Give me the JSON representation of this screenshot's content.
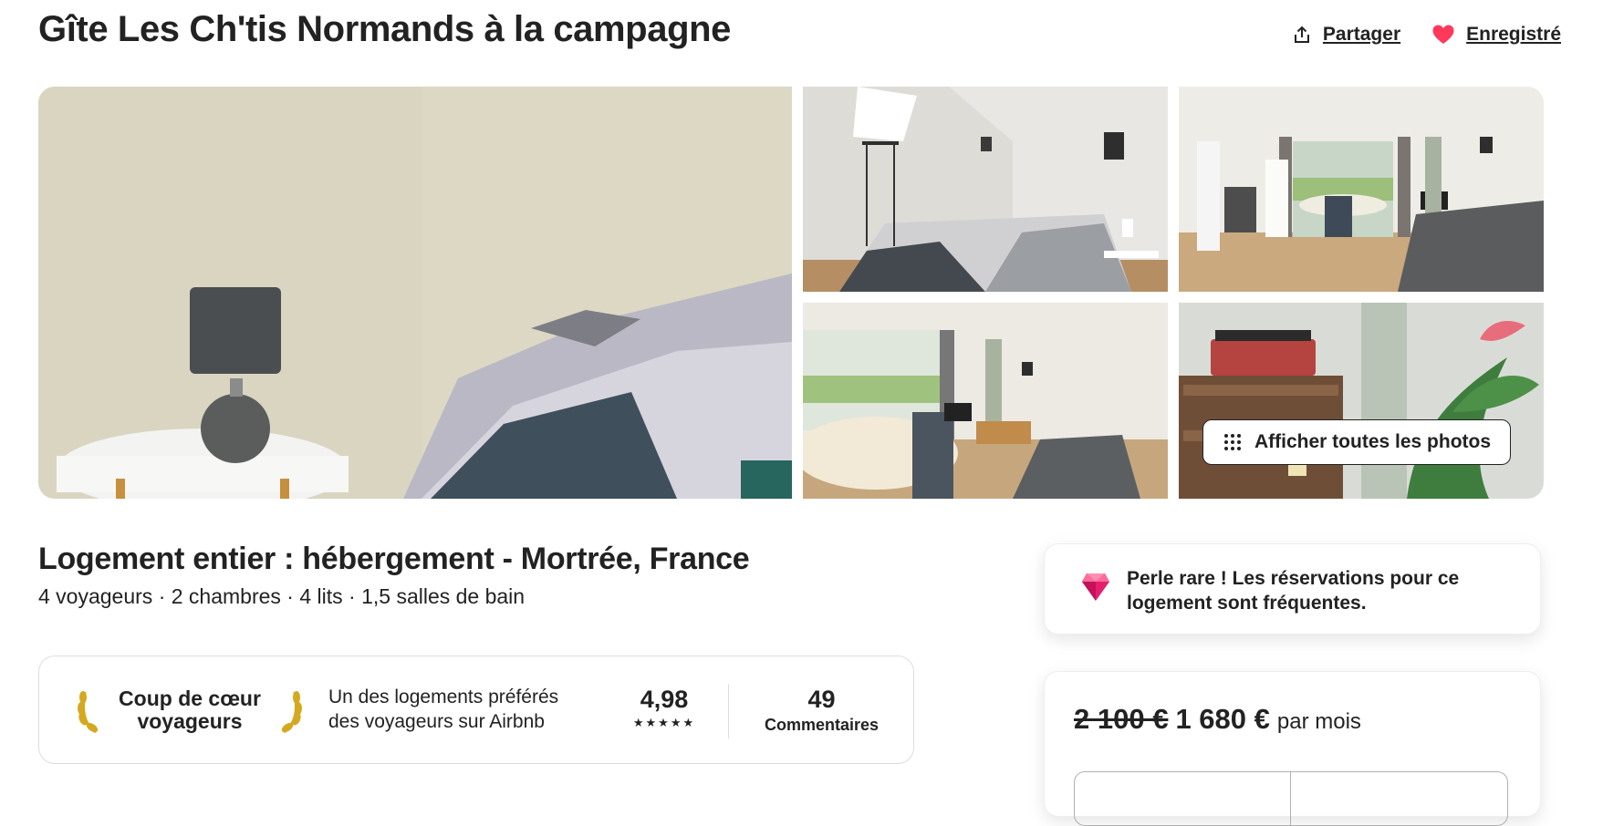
{
  "header": {
    "title": "Gîte Les Ch'tis Normands à la campagne",
    "share_label": "Partager",
    "save_label": "Enregistré",
    "share_icon": "share-icon",
    "save_icon": "heart-icon"
  },
  "gallery": {
    "photos": [
      {
        "subject": "bedside-lamp-photo"
      },
      {
        "subject": "bedroom-photo"
      },
      {
        "subject": "living-room-kitchen-photo"
      },
      {
        "subject": "dining-living-room-photo"
      },
      {
        "subject": "record-player-plant-photo"
      }
    ],
    "show_all_label": "Afficher toutes les photos",
    "show_all_icon": "grid-dots-icon"
  },
  "listing": {
    "title": "Logement entier : hébergement - Mortrée, France",
    "subtitle": "4 voyageurs · 2 chambres · 4 lits · 1,5 salles de bain"
  },
  "guest_favorite": {
    "badge_line1": "Coup de cœur",
    "badge_line2": "voyageurs",
    "description_line1": "Un des logements préférés",
    "description_line2": "des voyageurs sur Airbnb",
    "rating": "4,98",
    "stars": "★★★★★",
    "reviews_count": "49",
    "reviews_label": "Commentaires"
  },
  "rare_find": {
    "icon": "diamond-icon",
    "text_line1": "Perle rare ! Les réservations pour ce",
    "text_line2": "logement sont fréquentes."
  },
  "booking": {
    "old_price": "2 100 €",
    "new_price": "1 680 €",
    "unit": "par mois"
  },
  "colors": {
    "brand": "#ff385c",
    "text": "#222222",
    "border": "#dddddd",
    "gem": "#e61e6e"
  }
}
